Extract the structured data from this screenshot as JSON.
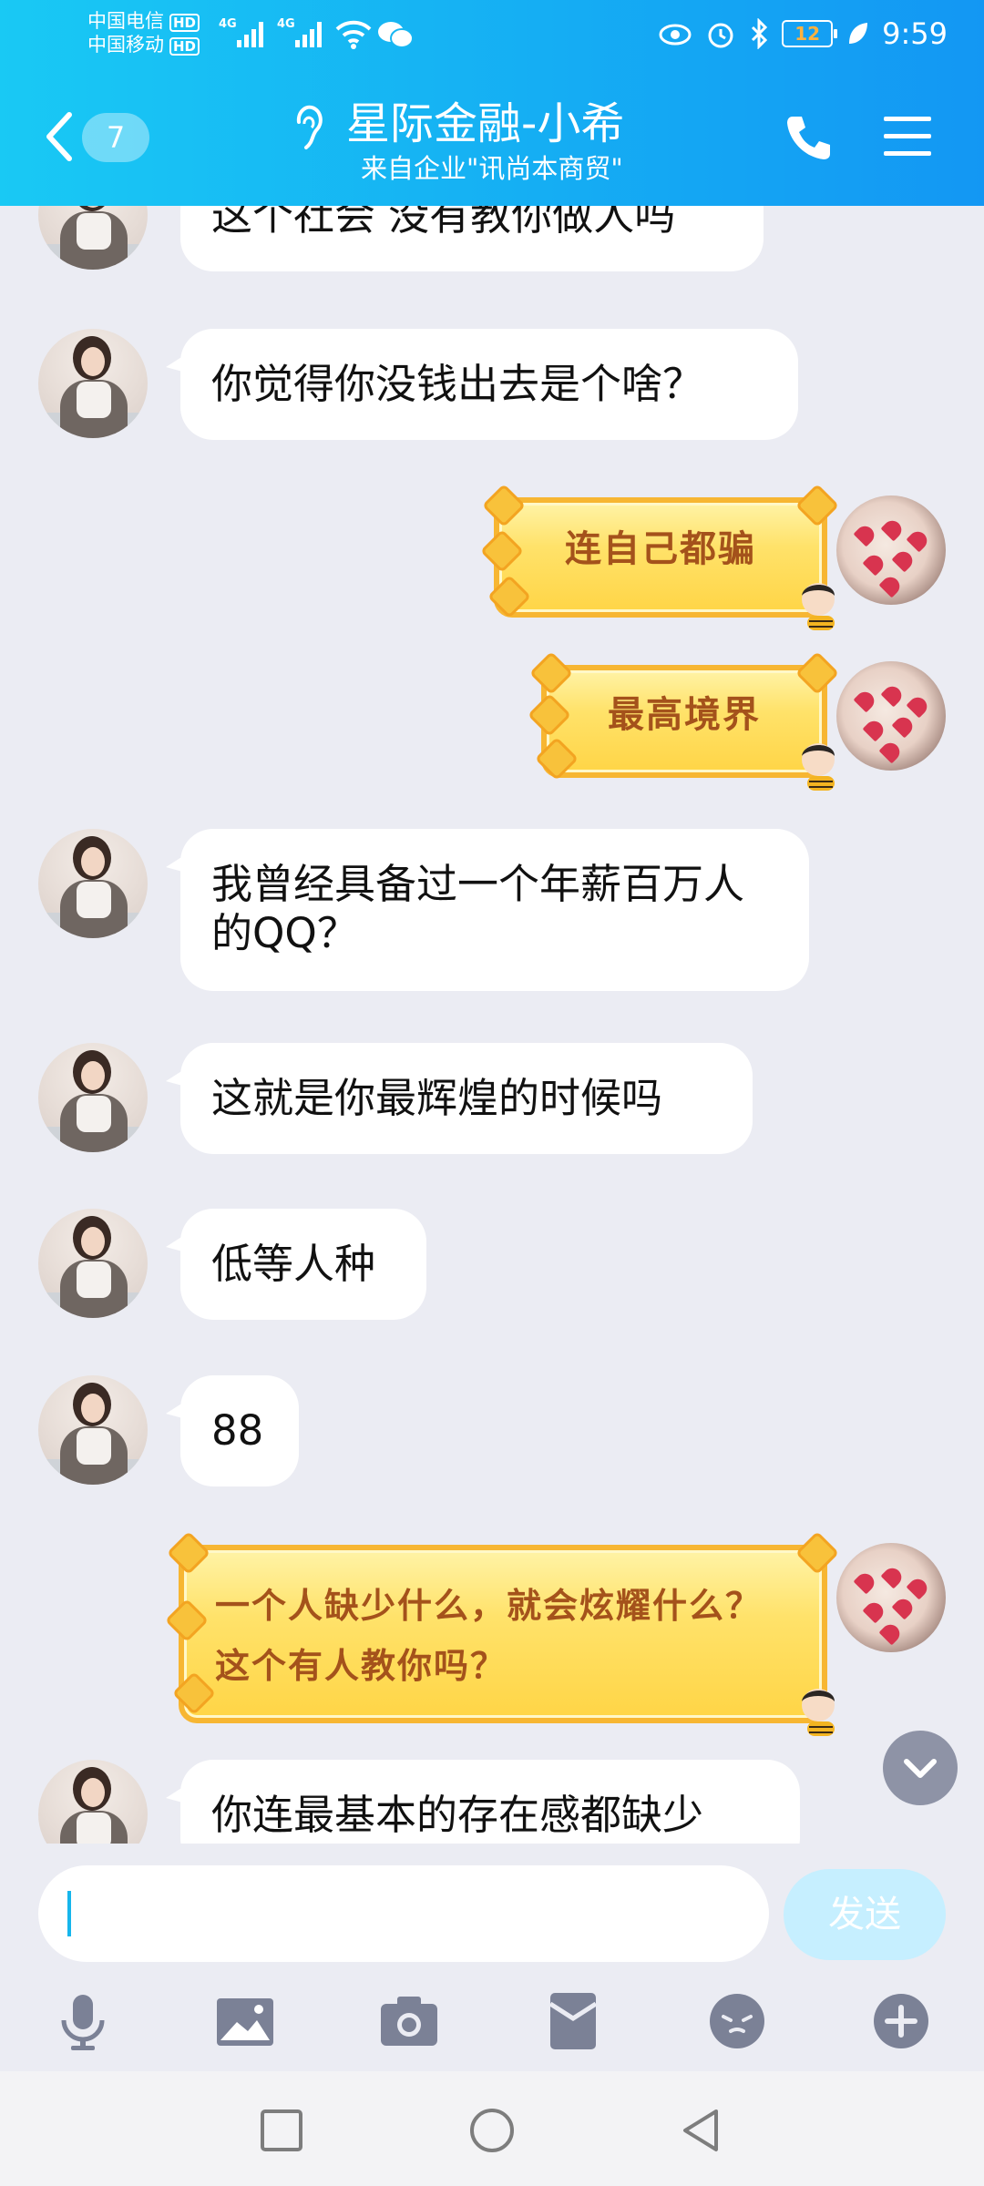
{
  "status_bar": {
    "carrier1": "中国电信",
    "carrier2": "中国移动",
    "hd": "HD",
    "net": "4G",
    "battery": "12",
    "time": "9:59"
  },
  "header": {
    "back_count": "7",
    "title": "星际金融-小希",
    "subtitle": "来自企业\"讯尚本商贸\""
  },
  "messages": [
    {
      "side": "left",
      "type": "text",
      "text": "这个社会 没有教你做人吗"
    },
    {
      "side": "left",
      "type": "text",
      "text": "你觉得你没钱出去是个啥？"
    },
    {
      "side": "right",
      "type": "sticker",
      "text": "连自己都骗"
    },
    {
      "side": "right",
      "type": "sticker",
      "text": "最高境界"
    },
    {
      "side": "left",
      "type": "text",
      "text": "我曾经具备过一个年薪百万人的QQ？"
    },
    {
      "side": "left",
      "type": "text",
      "text": "这就是你最辉煌的时候吗"
    },
    {
      "side": "left",
      "type": "text",
      "text": "低等人种"
    },
    {
      "side": "left",
      "type": "text",
      "text": "88"
    },
    {
      "side": "right",
      "type": "sticker",
      "text": "一个人缺少什么，就会炫耀什么？这个有人教你吗？"
    },
    {
      "side": "left",
      "type": "text",
      "text": "你连最基本的存在感都缺少"
    }
  ],
  "input": {
    "value": "",
    "send_label": "发送"
  },
  "toolbar": [
    "microphone-icon",
    "image-icon",
    "camera-icon",
    "red-packet-icon",
    "emoji-icon",
    "plus-icon"
  ],
  "colors": {
    "header": "#15aef3",
    "chat_bg": "#ebecf3",
    "bubble": "#ffffff",
    "send_disabled": "#c6efff",
    "sticker_text": "#a4521b"
  }
}
